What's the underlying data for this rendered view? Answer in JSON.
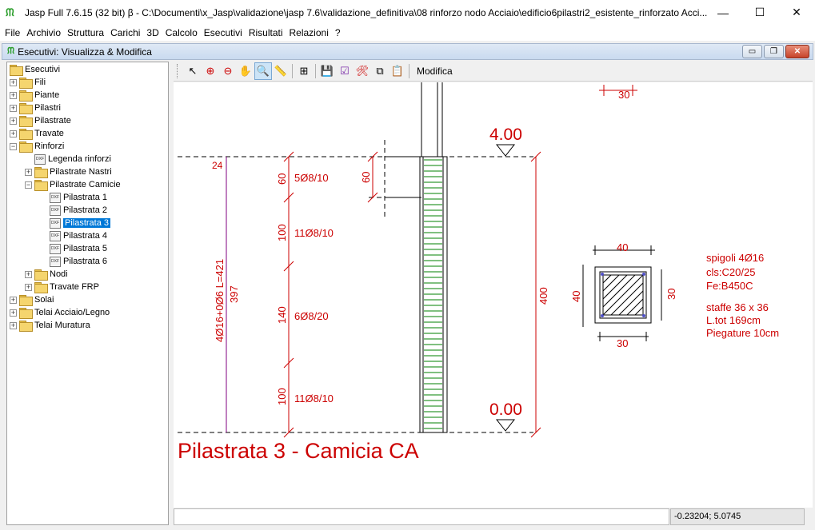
{
  "window": {
    "title": "Jasp Full 7.6.15 (32 bit)  β - C:\\Documenti\\x_Jasp\\validazione\\jasp 7.6\\validazione_definitiva\\08 rinforzo nodo Acciaio\\edificio6pilastri2_esistente_rinforzato Acci...",
    "app_icon": "ᙏ",
    "minimize": "—",
    "maximize": "☐",
    "close": "✕"
  },
  "menu": [
    "File",
    "Archivio",
    "Struttura",
    "Carichi",
    "3D",
    "Calcolo",
    "Esecutivi",
    "Risultati",
    "Relazioni",
    "?"
  ],
  "subwindow": {
    "title": "Esecutivi: Visualizza & Modifica",
    "minimize": "▭",
    "restore": "❐",
    "close": "✕"
  },
  "tree": {
    "root": "Esecutivi",
    "items": [
      {
        "label": "Fili",
        "type": "folder",
        "expander": "+"
      },
      {
        "label": "Piante",
        "type": "folder",
        "expander": "+"
      },
      {
        "label": "Pilastri",
        "type": "folder",
        "expander": "+"
      },
      {
        "label": "Pilastrate",
        "type": "folder",
        "expander": "+"
      },
      {
        "label": "Travate",
        "type": "folder",
        "expander": "+"
      },
      {
        "label": "Rinforzi",
        "type": "folder",
        "expander": "−"
      },
      {
        "label": "Legenda rinforzi",
        "type": "doc",
        "expander": ""
      },
      {
        "label": "Pilastrate Nastri",
        "type": "folder",
        "expander": "+"
      },
      {
        "label": "Pilastrate Camicie",
        "type": "folder",
        "expander": "−"
      },
      {
        "label": "Pilastrata 1",
        "type": "doc",
        "expander": ""
      },
      {
        "label": "Pilastrata 2",
        "type": "doc",
        "expander": ""
      },
      {
        "label": "Pilastrata 3",
        "type": "doc",
        "expander": "",
        "selected": true
      },
      {
        "label": "Pilastrata 4",
        "type": "doc",
        "expander": ""
      },
      {
        "label": "Pilastrata 5",
        "type": "doc",
        "expander": ""
      },
      {
        "label": "Pilastrata 6",
        "type": "doc",
        "expander": ""
      },
      {
        "label": "Nodi",
        "type": "folder",
        "expander": "+"
      },
      {
        "label": "Travate FRP",
        "type": "folder",
        "expander": "+"
      },
      {
        "label": "Solai",
        "type": "folder",
        "expander": "+"
      },
      {
        "label": "Telai Acciaio/Legno",
        "type": "folder",
        "expander": "+"
      },
      {
        "label": "Telai Muratura",
        "type": "folder",
        "expander": "+"
      }
    ],
    "doc_icon_text": "DXF"
  },
  "toolbar": {
    "icons": [
      "pointer-icon",
      "zoom-in-icon",
      "zoom-out-icon",
      "pan-icon",
      "zoom-window-icon",
      "measure-icon",
      "zoom-extents-icon",
      "save-icon",
      "check-icon",
      "tools-icon",
      "copy-icon",
      "paste-icon"
    ],
    "glyphs": [
      "↖",
      "⊕",
      "⊖",
      "✋",
      "🔍",
      "📏",
      "⊞",
      "💾",
      "☑",
      "🛠",
      "⧉",
      "📋"
    ],
    "label": "Modifica"
  },
  "drawing": {
    "top_level": "4.00",
    "bottom_level": "0.00",
    "height_400": "400",
    "dim_24": "24",
    "bar_label": "4Ø16+0Ø6 L=421",
    "bar_len": "397",
    "seg_60": "60",
    "seg_60_stirrups": "5Ø8/10",
    "seg_60_right": "60",
    "seg_100a": "100",
    "seg_100a_stirrups": "11Ø8/10",
    "seg_140": "140",
    "seg_140_stirrups": "6Ø8/20",
    "seg_100b": "100",
    "seg_100b_stirrups": "11Ø8/10",
    "top_30": "30",
    "section_40_top": "40",
    "section_40_left": "40",
    "section_30_right": "30",
    "section_30_bottom": "30",
    "notes": [
      "spigoli 4Ø16",
      "cls:C20/25",
      "Fe:B450C",
      "staffe 36 x 36",
      "L.tot 169cm",
      "Piegature 10cm"
    ],
    "caption": "Pilastrata 3 - Camicia CA",
    "accent_color": "#cc0000",
    "bar_color": "#800080",
    "stirrup_color": "#008000"
  },
  "status": {
    "coords": "-0.23204; 5.0745"
  }
}
